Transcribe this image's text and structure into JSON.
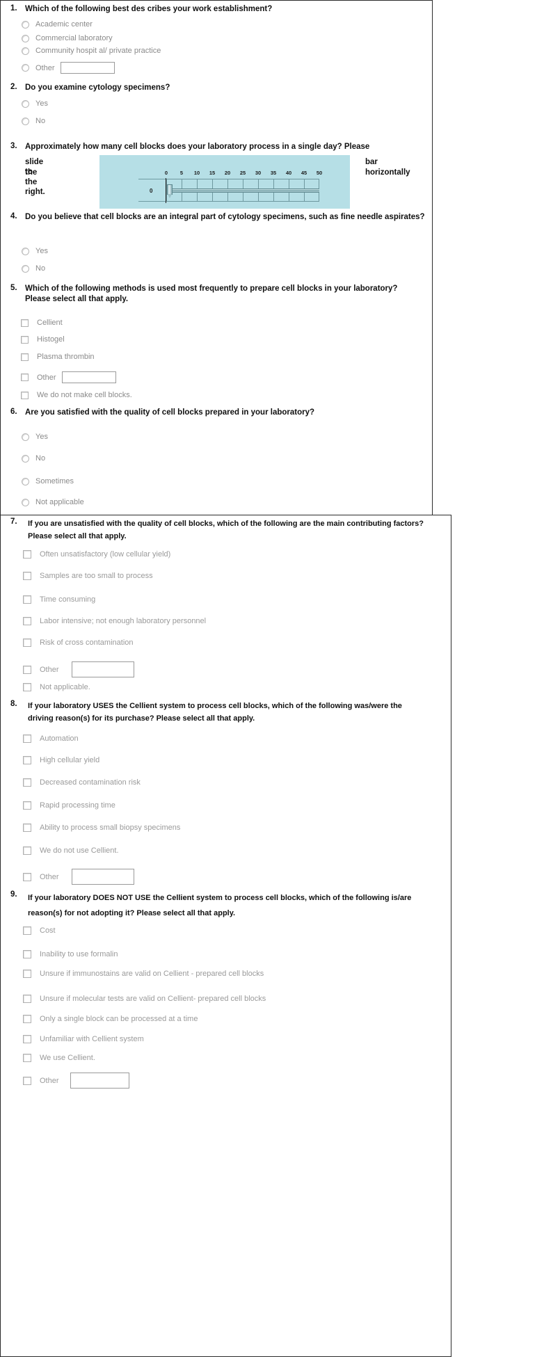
{
  "survey": {
    "slider": {
      "min": 0,
      "max": 50,
      "step": 5,
      "value": 0,
      "value_label": "0",
      "ticks": [
        "0",
        "5",
        "10",
        "15",
        "20",
        "25",
        "30",
        "35",
        "40",
        "45",
        "50"
      ],
      "background_color": "#b6dfe6",
      "line_color": "#6e989f"
    },
    "questions": [
      {
        "number": "1.",
        "text": "Which of the following best des cribes your work establishment?",
        "type": "radio",
        "options": [
          {
            "label": "Academic center",
            "has_textbox": false
          },
          {
            "label": "Commercial laboratory",
            "has_textbox": false
          },
          {
            "label": "Community hospit al/ private practice",
            "has_textbox": false
          },
          {
            "label": "Other",
            "has_textbox": true,
            "textbox_value": ""
          }
        ]
      },
      {
        "number": "2.",
        "text": "Do you examine cytology specimens?",
        "type": "radio",
        "options": [
          {
            "label": "Yes",
            "has_textbox": false
          },
          {
            "label": "No",
            "has_textbox": false
          }
        ]
      },
      {
        "number": "3.",
        "text_part1": "Approximately how many cell blocks does your laboratory process in a single day? Please",
        "text_part2": "slide the",
        "text_part3": "to the right.",
        "text_part4": "bar horizontally",
        "type": "slider"
      },
      {
        "number": "4.",
        "text": "Do you believe that cell blocks are an  integral part of cytology specimens, such as  fine needle aspirates?",
        "type": "radio",
        "options": [
          {
            "label": "Yes",
            "has_textbox": false
          },
          {
            "label": "No",
            "has_textbox": false
          }
        ]
      },
      {
        "number": "5.",
        "text": "Which of the following methods  is  used most frequently to prepare cell blocks in your laboratory? Please select all that apply.",
        "type": "checkbox",
        "options": [
          {
            "label": "Cellient",
            "has_textbox": false
          },
          {
            "label": "Histogel",
            "has_textbox": false
          },
          {
            "label": "Plasma thrombin",
            "has_textbox": false
          },
          {
            "label": "Other",
            "has_textbox": true,
            "textbox_value": ""
          },
          {
            "label": "We do not make cell blocks.",
            "has_textbox": false
          }
        ]
      },
      {
        "number": "6.",
        "text": "Are you satisfied with the quality of cell blocks prepared in your laboratory?",
        "type": "radio",
        "options": [
          {
            "label": "Yes",
            "has_textbox": false
          },
          {
            "label": "No",
            "has_textbox": false
          },
          {
            "label": "Sometimes",
            "has_textbox": false
          },
          {
            "label": "Not applicable",
            "has_textbox": false
          }
        ]
      },
      {
        "number": "7.",
        "text": "If you are unsatisfied with the quality of cell blocks, which of the following are the main contributing factors? Please select all that apply.",
        "type": "checkbox",
        "options": [
          {
            "label": "Often unsatisfactory (low cellular yield)",
            "has_textbox": false
          },
          {
            "label": "Samples are too small to process",
            "has_textbox": false
          },
          {
            "label": "Time consuming",
            "has_textbox": false
          },
          {
            "label": "Labor intensive; not enough laboratory personnel",
            "has_textbox": false
          },
          {
            "label": "Risk of cross contamination",
            "has_textbox": false
          },
          {
            "label": "Other",
            "has_textbox": true,
            "textbox_value": ""
          },
          {
            "label": "Not applicable.",
            "has_textbox": false
          }
        ]
      },
      {
        "number": "8.",
        "text": "If your laboratory USES the Cellient system to process cell blocks, which of the following was/were the driving reason(s) for its purchase? Please select all that apply.",
        "type": "checkbox",
        "options": [
          {
            "label": "Automation",
            "has_textbox": false
          },
          {
            "label": "High cellular yield",
            "has_textbox": false
          },
          {
            "label": "Decreased contamination risk",
            "has_textbox": false
          },
          {
            "label": "Rapid processing time",
            "has_textbox": false
          },
          {
            "label": "Ability to process small biopsy specimens",
            "has_textbox": false
          },
          {
            "label": "We do not use Cellient.",
            "has_textbox": false
          },
          {
            "label": "Other",
            "has_textbox": true,
            "textbox_value": ""
          }
        ]
      },
      {
        "number": "9.",
        "text": "If your laboratory DOES NOT USE the Cellient system to process cell blocks, which of the following is/are reason(s) for not adopting it? Please select all that apply.",
        "type": "checkbox",
        "options": [
          {
            "label": "Cost",
            "has_textbox": false
          },
          {
            "label": "Inability to use formalin",
            "has_textbox": false
          },
          {
            "label": "Unsure if immunostains are valid on Cellient - prepared cell blocks",
            "has_textbox": false
          },
          {
            "label": "Unsure if molecular tests are valid on Cellient- prepared cell blocks",
            "has_textbox": false
          },
          {
            "label": "Only a single block can be processed at a time",
            "has_textbox": false
          },
          {
            "label": "Unfamiliar with Cellient system",
            "has_textbox": false
          },
          {
            "label": "We use Cellient.",
            "has_textbox": false
          },
          {
            "label": "Other",
            "has_textbox": true,
            "textbox_value": ""
          }
        ]
      }
    ]
  }
}
